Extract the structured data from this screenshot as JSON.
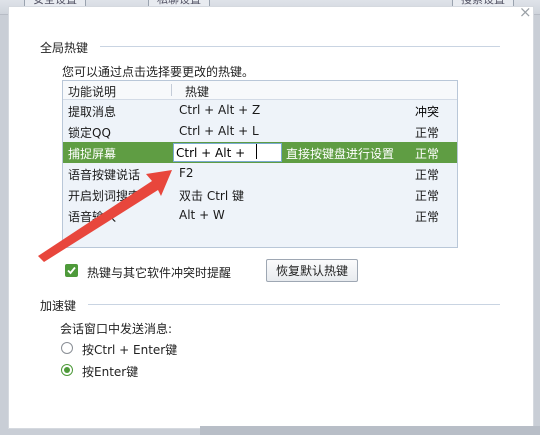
{
  "window": {
    "bg_tabs": [
      "安全设置",
      "私聊设置",
      "搜索设置"
    ],
    "close_symbol": "×"
  },
  "global_hotkeys": {
    "title": "全局热键",
    "description": "您可以通过点击选择要更改的热键。",
    "columns": [
      "功能说明",
      "热键"
    ],
    "rows": [
      {
        "name": "提取消息",
        "hotkey": "Ctrl + Alt + Z",
        "status": "冲突"
      },
      {
        "name": "锁定QQ",
        "hotkey": "Ctrl + Alt + L",
        "status": "正常"
      },
      {
        "name": "捕捉屏幕",
        "hotkey": "Ctrl + Alt + ",
        "hint": "直接按键盘进行设置",
        "status": "正常"
      },
      {
        "name": "语音按键说话",
        "hotkey": "F2",
        "status": "正常"
      },
      {
        "name": "开启划词搜索",
        "hotkey": "双击 Ctrl 键",
        "status": "正常"
      },
      {
        "name": "语音输入",
        "hotkey": "Alt + W",
        "status": "正常"
      }
    ],
    "conflict_checkbox_label": "热键与其它软件冲突时提醒",
    "restore_button": "恢复默认热键"
  },
  "accelerators": {
    "title": "加速键",
    "send_label": "会话窗口中发送消息:",
    "options": [
      "按Ctrl + Enter键",
      "按Enter键"
    ],
    "selected_option": "按Enter键"
  },
  "colors": {
    "selected_row": "#5f9d43",
    "accent_green": "#4e9a3a",
    "annotation_arrow": "#e8463c"
  }
}
